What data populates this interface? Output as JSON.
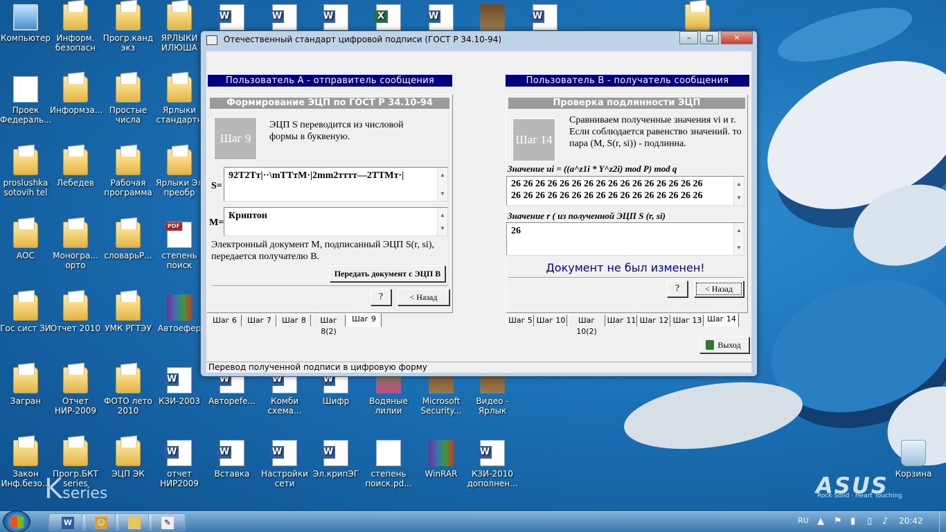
{
  "desktop_icons": [
    {
      "label": "Компьютер",
      "type": "comp"
    },
    {
      "label": "Информ. безопасн",
      "type": "folder"
    },
    {
      "label": "Прогр.канд экз",
      "type": "folder"
    },
    {
      "label": "ЯРЛЫКИ ИЛЮША",
      "type": "folder"
    },
    {
      "label": "Проек Федераль...",
      "type": "doc"
    },
    {
      "label": "Информза...",
      "type": "folder"
    },
    {
      "label": "Простые числа",
      "type": "folder"
    },
    {
      "label": "Ярлыки стандартн",
      "type": "folder"
    },
    {
      "label": "proslushka sotovih tel",
      "type": "folder"
    },
    {
      "label": "Лебедев",
      "type": "folder"
    },
    {
      "label": "Рабочая программа",
      "type": "folder"
    },
    {
      "label": "Ярлыки Эл преобр",
      "type": "folder"
    },
    {
      "label": "АОС",
      "type": "folder"
    },
    {
      "label": "Моногра... орто",
      "type": "folder"
    },
    {
      "label": "словарьР...",
      "type": "folder"
    },
    {
      "label": "степень поиск",
      "type": "pdf"
    },
    {
      "label": "Гос сист ЗИ",
      "type": "folder"
    },
    {
      "label": "Отчет 2010",
      "type": "folder"
    },
    {
      "label": "УМК РГТЭУ",
      "type": "folder"
    },
    {
      "label": "Автоефер",
      "type": "rar"
    },
    {
      "label": "Загран",
      "type": "folder"
    },
    {
      "label": "Отчет НИР-2009",
      "type": "folder"
    },
    {
      "label": "ФОТО лето 2010",
      "type": "folder"
    },
    {
      "label": "КЗИ-2003",
      "type": "word"
    },
    {
      "label": "Автореfe...",
      "type": "word"
    },
    {
      "label": "Комби схема...",
      "type": "word"
    },
    {
      "label": "Шифр",
      "type": "word"
    },
    {
      "label": "Водяные лилии",
      "type": "img"
    },
    {
      "label": "Microsoft Security...",
      "type": "app"
    },
    {
      "label": "Видео - Ярлык",
      "type": "app"
    },
    {
      "label": "Закон Инф.безо...",
      "type": "folder"
    },
    {
      "label": "Прогр.БКТ series",
      "type": "folder"
    },
    {
      "label": "ЭЦП ЭК",
      "type": "folder"
    },
    {
      "label": "отчет НИР2009",
      "type": "word"
    },
    {
      "label": "Вставка",
      "type": "word"
    },
    {
      "label": "Настройки сети",
      "type": "word"
    },
    {
      "label": "Эл.крипЭГ",
      "type": "word"
    },
    {
      "label": "степень поиск.pd...",
      "type": "doc"
    },
    {
      "label": "WinRAR",
      "type": "rar"
    },
    {
      "label": "КЗИ-2010 дополнен...",
      "type": "word"
    },
    {
      "label": "Корзина",
      "type": "trash"
    },
    {
      "label": "",
      "type": "word"
    },
    {
      "label": "",
      "type": "word"
    },
    {
      "label": "",
      "type": "word"
    },
    {
      "label": "",
      "type": "excel"
    },
    {
      "label": "",
      "type": "word"
    },
    {
      "label": "",
      "type": "app"
    },
    {
      "label": "",
      "type": "word"
    },
    {
      "label": "",
      "type": "folder"
    }
  ],
  "window": {
    "title": "Отечественный стандарт цифровой подписи (ГОСТ Р 34.10-94)",
    "minimize": "–",
    "maximize": "□",
    "close": "✕",
    "status": "Перевод полученной подписи в цифровую форму",
    "left": {
      "header": "Пользователь А - отправитель сообщения",
      "subheader": "Формирование ЭЦП по ГОСТ Р 34.10-94",
      "step": "Шаг 9",
      "step_text": "ЭЦП S переводится из числовой формы в буквеную.",
      "s_label": "S=",
      "s_value": "92Т2Тт|··\\mТТтМ·|2mm2тттт—2ТТМт·|",
      "m_label": "M=",
      "m_value": "Криптон",
      "info": "Электронный документ М, подписанный ЭЦП S(r, si), передается получателю В.",
      "send_button": "Передать документ с ЭЦП В",
      "help_button": "?",
      "back_button": "< Назад",
      "tabs": [
        "Шаг 6",
        "Шаг 7",
        "Шаг 8",
        "Шаг 8(2)",
        "Шаг 9"
      ],
      "active_tab": "Шаг 9"
    },
    "right": {
      "header": "Пользователь В - получатель сообщения",
      "subheader": "Проверка подлинности ЭЦП",
      "step": "Шаг 14",
      "step_text": "Сравниваем полученные значения vi и r. Если соблюдается равенство значений. то пара (M, S(r, si)) - подлинна.",
      "u_label": "Значение ui = ((a^z1i * Y^z2i) mod P) mod q",
      "u_line1": "26 26 26 26 26 26 26 26 26 26 26 26 26 26 26 26",
      "u_line2": "26 26 26 26 26 26 26 26 26 26 26 26 26 26 26 26",
      "r_label": "Значение  r ( из полученной ЭЦП S (r, si)",
      "r_value": "26",
      "result": "Документ не был изменен!",
      "help_button": "?",
      "back_button": "< Назад",
      "tabs": [
        "Шаг 5",
        "Шаг 10",
        "Шаг 10(2)",
        "Шаг 11",
        "Шаг 12",
        "Шаг 13",
        "Шаг 14"
      ],
      "active_tab": "Шаг 14"
    },
    "exit_button": "Выход"
  },
  "taskbar": {
    "lang": "RU",
    "time": "20:42"
  },
  "branding": {
    "asus": "ASUS",
    "asus_tagline": "Rock Solid · Heart Touching",
    "kseries": "K",
    "kseries_suffix": "series"
  }
}
